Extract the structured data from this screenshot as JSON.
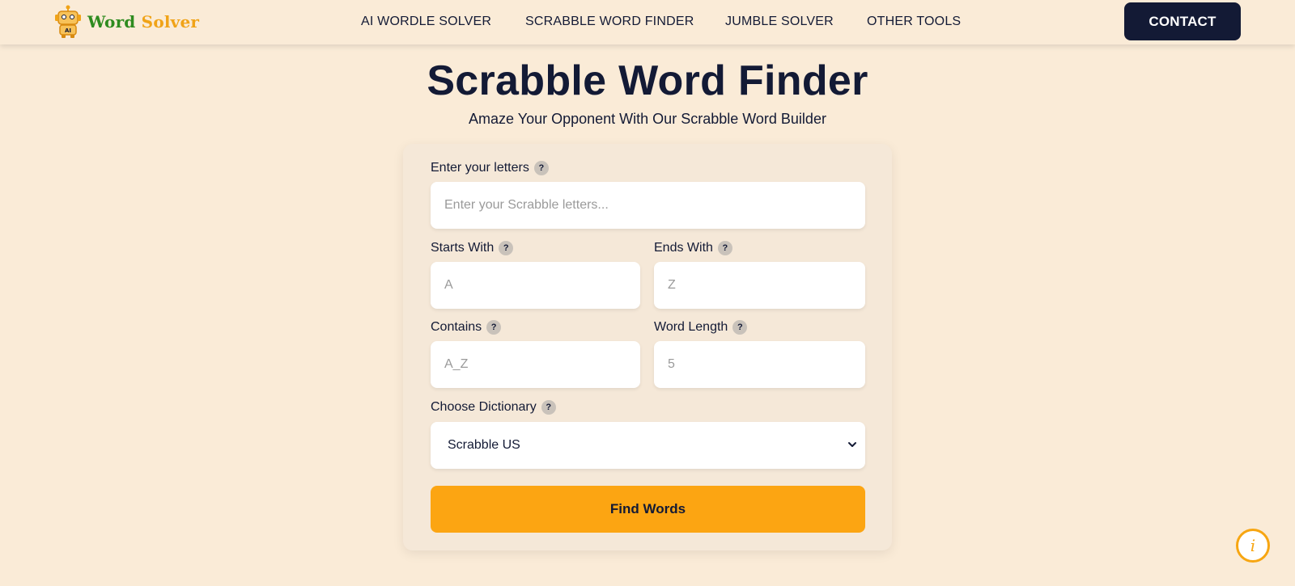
{
  "header": {
    "logo_word": "Word",
    "logo_solver": "Solver",
    "robot_badge": "AI",
    "nav": [
      {
        "label": "AI WORDLE SOLVER"
      },
      {
        "label": "SCRABBLE WORD FINDER"
      },
      {
        "label": "JUMBLE SOLVER"
      },
      {
        "label": "OTHER TOOLS"
      }
    ],
    "contact_label": "CONTACT"
  },
  "main": {
    "title": "Scrabble Word Finder",
    "subtitle": "Amaze Your Opponent With Our Scrabble Word Builder"
  },
  "form": {
    "help_glyph": "?",
    "letters": {
      "label": "Enter your letters",
      "value": "",
      "placeholder": "Enter your Scrabble letters..."
    },
    "starts_with": {
      "label": "Starts With",
      "value": "",
      "placeholder": "A"
    },
    "ends_with": {
      "label": "Ends With",
      "value": "",
      "placeholder": "Z"
    },
    "contains": {
      "label": "Contains",
      "value": "",
      "placeholder": "A_Z"
    },
    "word_length": {
      "label": "Word Length",
      "value": "",
      "placeholder": "5"
    },
    "dictionary": {
      "label": "Choose Dictionary",
      "selected": "Scrabble US"
    },
    "submit_label": "Find Words"
  },
  "info_button": {
    "glyph": "i"
  },
  "colors": {
    "background": "#faebd7",
    "navy": "#131a35",
    "accent_orange": "#fca512",
    "logo_green": "#2e8b1f",
    "logo_orange": "#f0a318"
  },
  "icons": {
    "logo": "robot-icon",
    "help": "question-mark-icon",
    "select": "chevron-down-icon",
    "info": "info-icon"
  }
}
